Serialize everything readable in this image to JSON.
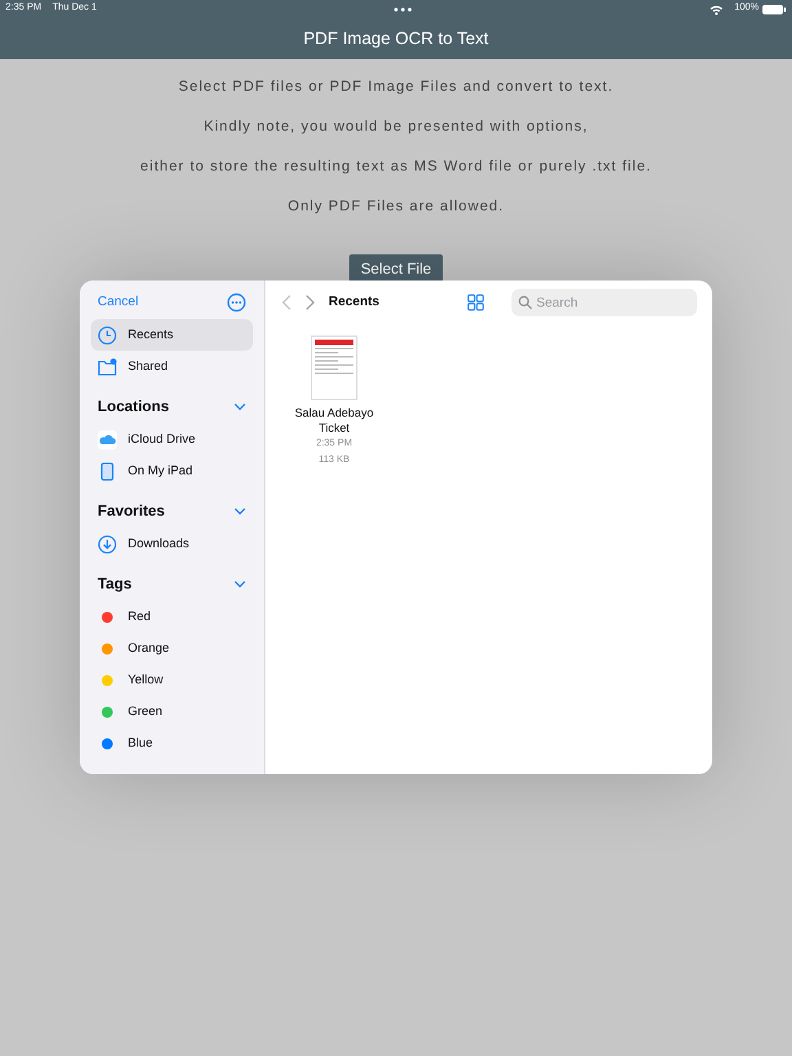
{
  "status_bar": {
    "time": "2:35 PM",
    "date": "Thu Dec 1",
    "battery": "100%"
  },
  "app": {
    "title": "PDF Image OCR to Text",
    "instructions": [
      "Select PDF files or PDF Image Files and convert to text.",
      "Kindly note, you would be presented with options,",
      "either to store the resulting text as MS Word file or purely .txt file.",
      "Only PDF Files are allowed."
    ],
    "button": "Select File"
  },
  "picker": {
    "cancel": "Cancel",
    "top_items": [
      {
        "label": "Recents",
        "kind": "clock",
        "selected": true
      },
      {
        "label": "Shared",
        "kind": "shared",
        "selected": false
      }
    ],
    "sections": [
      {
        "title": "Locations",
        "expanded": true,
        "items": [
          {
            "label": "iCloud Drive",
            "kind": "cloud",
            "selected": false
          },
          {
            "label": "On My iPad",
            "kind": "ipad",
            "selected": false
          }
        ]
      },
      {
        "title": "Favorites",
        "expanded": true,
        "items": [
          {
            "label": "Downloads",
            "kind": "download",
            "selected": false
          }
        ]
      },
      {
        "title": "Tags",
        "expanded": true,
        "items": [
          {
            "label": "Red",
            "kind": "tag",
            "color": "#ff3b30",
            "selected": false
          },
          {
            "label": "Orange",
            "kind": "tag",
            "color": "#ff9500",
            "selected": false
          },
          {
            "label": "Yellow",
            "kind": "tag",
            "color": "#ffcc00",
            "selected": false
          },
          {
            "label": "Green",
            "kind": "tag",
            "color": "#34c759",
            "selected": false
          },
          {
            "label": "Blue",
            "kind": "tag",
            "color": "#007aff",
            "selected": false
          }
        ]
      }
    ],
    "toolbar": {
      "title": "Recents",
      "search_placeholder": "Search"
    },
    "files": [
      {
        "name": "Salau Adebayo Ticket",
        "time": "2:35 PM",
        "size": "113 KB"
      }
    ]
  }
}
